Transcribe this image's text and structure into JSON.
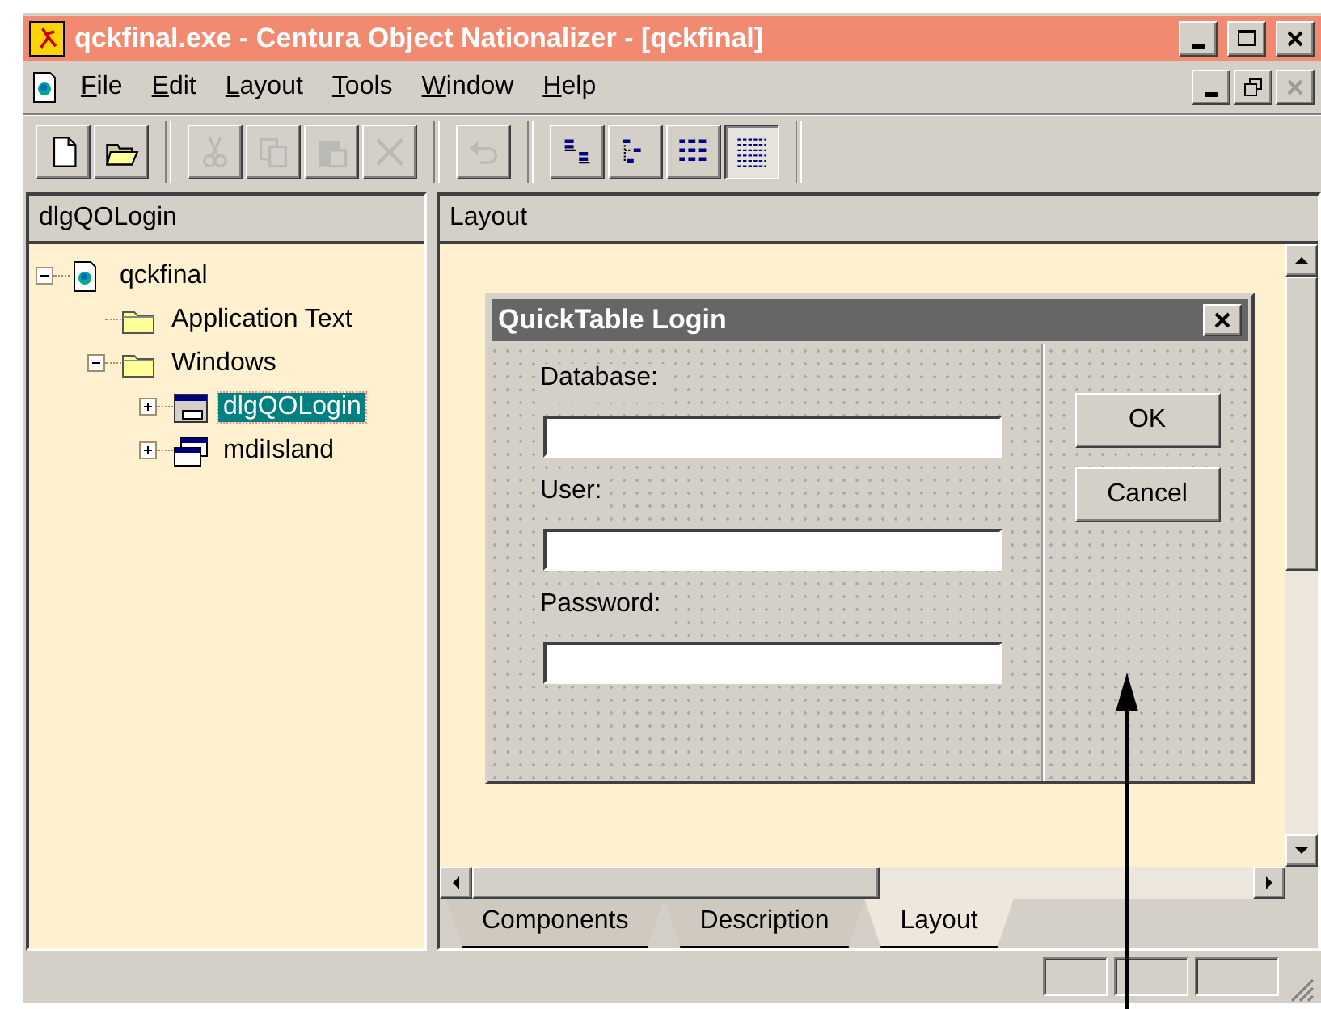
{
  "window": {
    "title": "qckfinal.exe - Centura Object Nationalizer - [qckfinal]"
  },
  "menu": [
    {
      "label": "File"
    },
    {
      "label": "Edit"
    },
    {
      "label": "Layout"
    },
    {
      "label": "Tools"
    },
    {
      "label": "Window"
    },
    {
      "label": "Help"
    }
  ],
  "toolbar": [
    [
      {
        "kind": "new",
        "disabled": false
      },
      {
        "kind": "open",
        "disabled": false
      }
    ],
    [
      {
        "kind": "cut",
        "disabled": true
      },
      {
        "kind": "copy",
        "disabled": true
      },
      {
        "kind": "paste",
        "disabled": true
      },
      {
        "kind": "delete",
        "disabled": true
      }
    ],
    [
      {
        "kind": "undo",
        "disabled": true
      }
    ],
    [
      {
        "kind": "labels",
        "selected": false
      },
      {
        "kind": "tree",
        "selected": false
      },
      {
        "kind": "list",
        "selected": false
      },
      {
        "kind": "grid",
        "selected": true
      }
    ]
  ],
  "tree_pane": {
    "title": "dlgQOLogin",
    "items": [
      {
        "label": "qckfinal",
        "kind": "app",
        "expanded": true,
        "selected": false,
        "children": [
          {
            "label": "Application Text",
            "kind": "folder",
            "selected": false
          },
          {
            "label": "Windows",
            "kind": "folder",
            "expanded": true,
            "selected": false,
            "children": [
              {
                "label": "dlgQOLogin",
                "kind": "dialog",
                "expanded": false,
                "selected": true
              },
              {
                "label": "mdiIsland",
                "kind": "window",
                "expanded": false,
                "selected": false
              }
            ]
          }
        ]
      }
    ]
  },
  "layout_pane": {
    "title": "Layout",
    "dialog": {
      "title": "QuickTable Login",
      "fields": [
        {
          "label": "Database:"
        },
        {
          "label": "User:"
        },
        {
          "label": "Password:"
        }
      ],
      "buttons": [
        "OK",
        "Cancel"
      ]
    },
    "tabs": [
      {
        "label": "Components",
        "selected": false
      },
      {
        "label": "Description",
        "selected": false
      },
      {
        "label": "Layout",
        "selected": true
      }
    ]
  }
}
